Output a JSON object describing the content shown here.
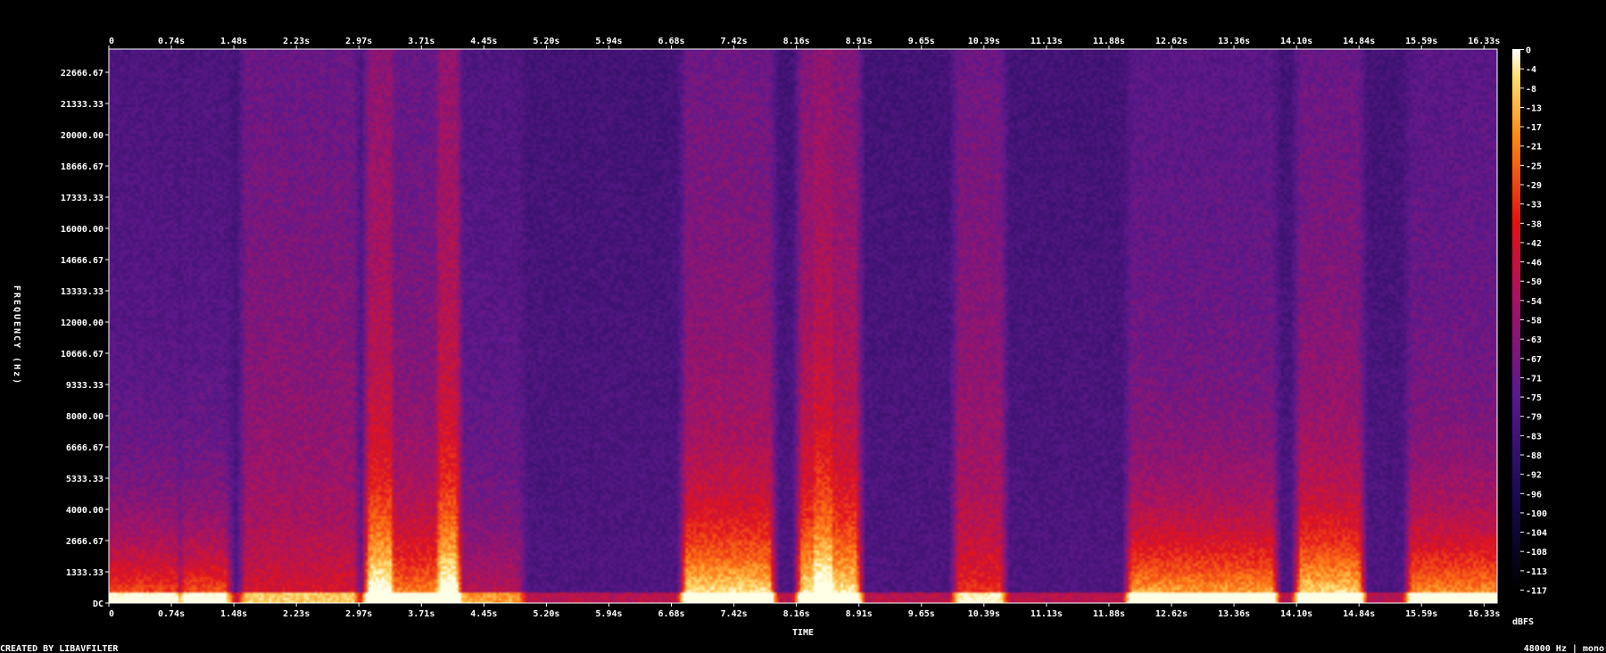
{
  "chart_data": {
    "type": "heatmap",
    "title": "",
    "xlabel": "TIME",
    "ylabel": "FREQUENCY (Hz)",
    "x_unit": "s",
    "x_ticks": [
      "0",
      "0.74s",
      "1.48s",
      "2.23s",
      "2.97s",
      "3.71s",
      "4.45s",
      "5.20s",
      "5.94s",
      "6.68s",
      "7.42s",
      "8.16s",
      "8.91s",
      "9.65s",
      "10.39s",
      "11.13s",
      "11.88s",
      "12.62s",
      "13.36s",
      "14.10s",
      "14.84s",
      "15.59s",
      "16.33s"
    ],
    "y_ticks": [
      "DC",
      "1333.33",
      "2666.67",
      "4000.00",
      "5333.33",
      "6666.67",
      "8000.00",
      "9333.33",
      "10666.67",
      "12000.00",
      "13333.33",
      "14666.67",
      "16000.00",
      "17333.33",
      "18666.67",
      "20000.00",
      "21333.33",
      "22666.67"
    ],
    "xlim": [
      0,
      16.85
    ],
    "ylim": [
      0,
      24000
    ],
    "colorbar": {
      "label": "dBFS",
      "ticks": [
        "0",
        "-4",
        "-8",
        "-13",
        "-17",
        "-21",
        "-25",
        "-29",
        "-33",
        "-38",
        "-42",
        "-46",
        "-50",
        "-54",
        "-58",
        "-63",
        "-67",
        "-71",
        "-75",
        "-79",
        "-83",
        "-88",
        "-92",
        "-96",
        "-100",
        "-104",
        "-108",
        "-113",
        "-117"
      ],
      "range": [
        -120,
        0
      ]
    },
    "events": [
      {
        "t0": 0.05,
        "t1": 0.75,
        "level": 0.78,
        "broadband": 0.15
      },
      {
        "t0": 0.95,
        "t1": 1.35,
        "level": 0.8,
        "broadband": 0.15
      },
      {
        "t0": 1.7,
        "t1": 2.9,
        "level": 0.3,
        "broadband": 0.55
      },
      {
        "t0": 3.2,
        "t1": 3.35,
        "level": 0.9,
        "broadband": 0.9
      },
      {
        "t0": 3.4,
        "t1": 4.15,
        "level": 0.7,
        "broadband": 0.5
      },
      {
        "t0": 4.05,
        "t1": 4.15,
        "level": 0.9,
        "broadband": 0.95
      },
      {
        "t0": 4.2,
        "t1": 4.9,
        "level": 0.4,
        "broadband": 0.2
      },
      {
        "t0": 7.05,
        "t1": 7.95,
        "level": 0.9,
        "broadband": 0.6
      },
      {
        "t0": 8.45,
        "t1": 9.0,
        "level": 0.8,
        "broadband": 0.8
      },
      {
        "t0": 8.6,
        "t1": 8.7,
        "level": 0.95,
        "broadband": 0.95
      },
      {
        "t0": 10.35,
        "t1": 10.75,
        "level": 0.4,
        "broadband": 0.6
      },
      {
        "t0": 12.45,
        "t1": 14.05,
        "level": 0.9,
        "broadband": 0.35
      },
      {
        "t0": 14.5,
        "t1": 15.1,
        "level": 0.9,
        "broadband": 0.55
      },
      {
        "t0": 15.85,
        "t1": 16.85,
        "level": 0.85,
        "broadband": 0.35
      }
    ],
    "colors": {
      "low": "#1a0b40",
      "mid": "#6a1488",
      "high": "#e5101a",
      "peak": "#ffd060"
    }
  },
  "footer": {
    "credit": "CREATED BY LIBAVFILTER",
    "format": "48000 Hz | mono"
  }
}
